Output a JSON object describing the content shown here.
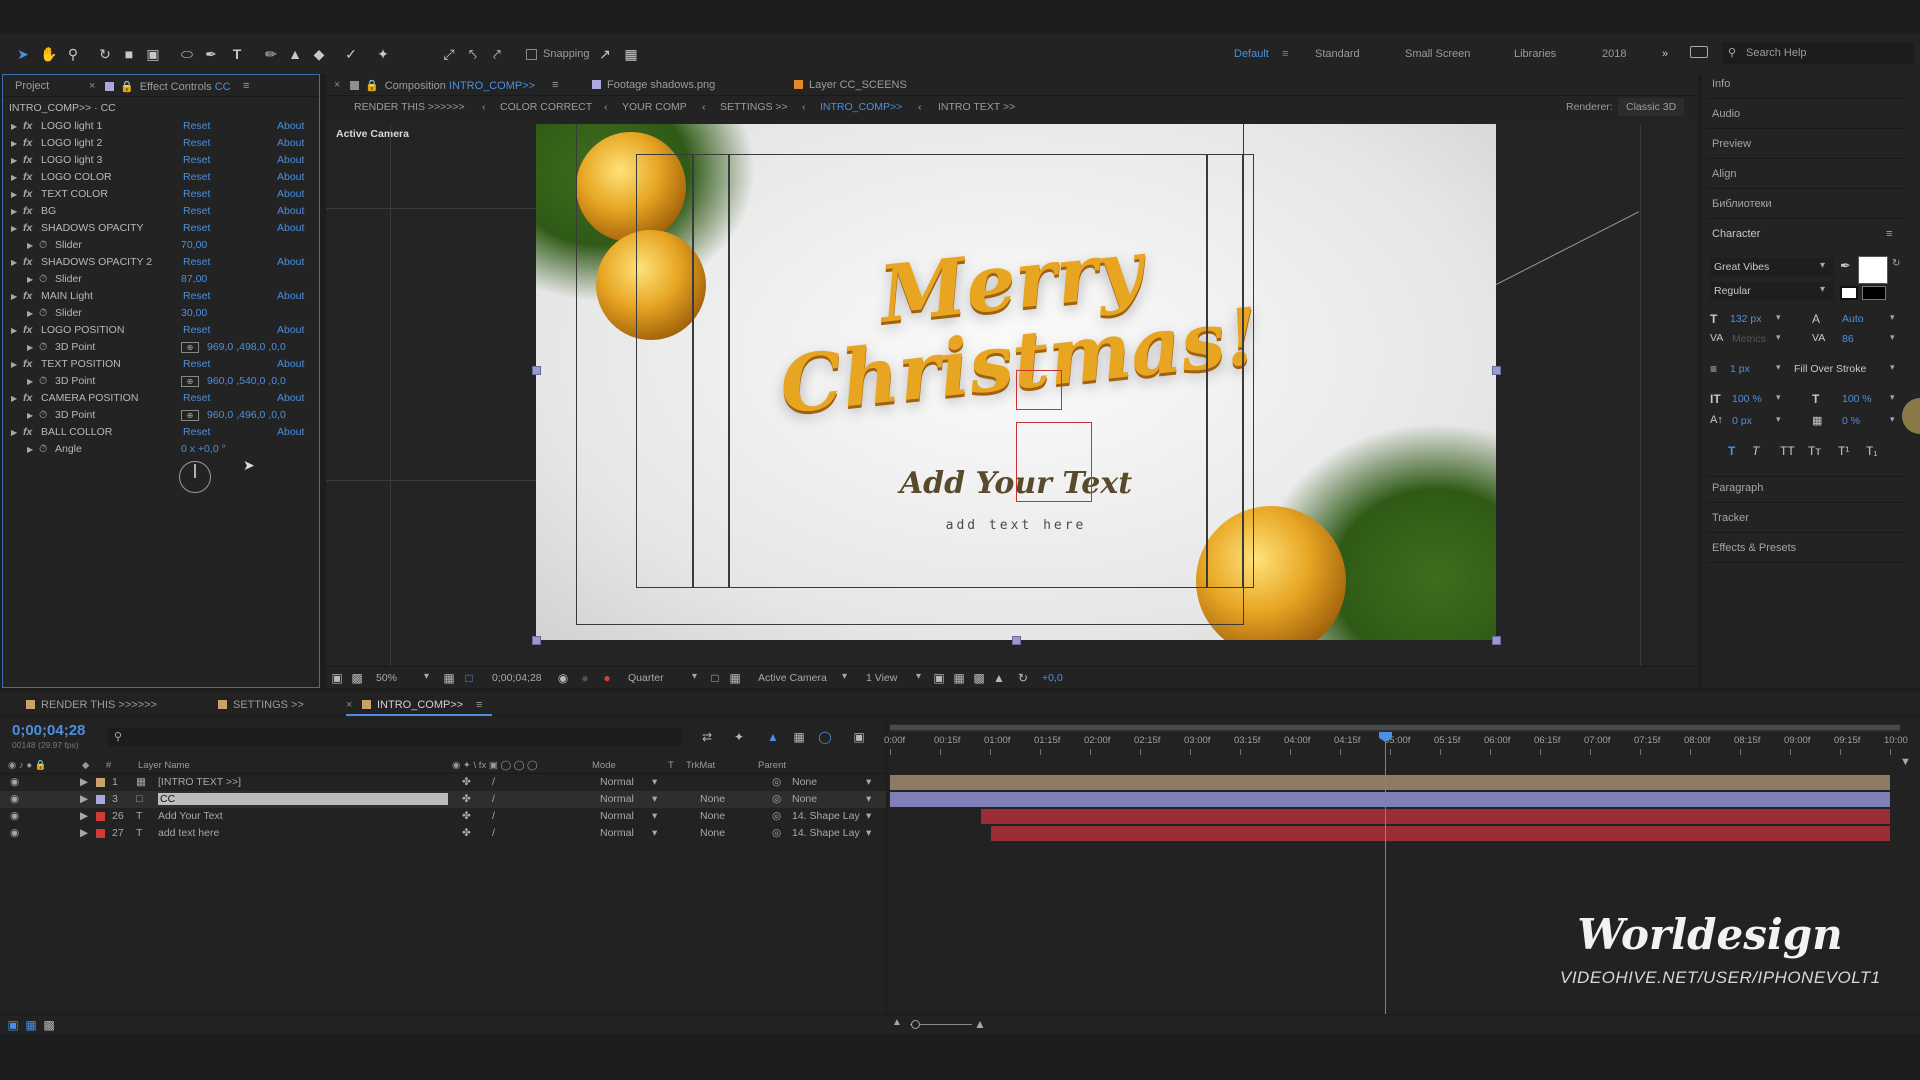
{
  "toolbar": {
    "snapping_label": "Snapping",
    "workspaces": [
      "Default",
      "Standard",
      "Small Screen",
      "Libraries",
      "2018"
    ],
    "search_placeholder": "Search Help"
  },
  "left_panel": {
    "tab_project": "Project",
    "tab_effect_controls": "Effect Controls",
    "tab_effect_target": "CC",
    "header": "INTRO_COMP>> · CC",
    "effects": [
      {
        "name": "LOGO light 1",
        "reset": "Reset",
        "about": "About"
      },
      {
        "name": "LOGO light 2",
        "reset": "Reset",
        "about": "About"
      },
      {
        "name": "LOGO light 3",
        "reset": "Reset",
        "about": "About"
      },
      {
        "name": "LOGO COLOR",
        "reset": "Reset",
        "about": "About"
      },
      {
        "name": "TEXT COLOR",
        "reset": "Reset",
        "about": "About"
      },
      {
        "name": "BG",
        "reset": "Reset",
        "about": "About"
      },
      {
        "name": "SHADOWS OPACITY",
        "reset": "Reset",
        "about": "About"
      },
      {
        "name": "Slider",
        "value": "70,00"
      },
      {
        "name": "SHADOWS OPACITY 2",
        "reset": "Reset",
        "about": "About"
      },
      {
        "name": "Slider",
        "value": "87,00"
      },
      {
        "name": "MAIN Light",
        "reset": "Reset",
        "about": "About"
      },
      {
        "name": "Slider",
        "value": "30,00"
      },
      {
        "name": "LOGO POSITION",
        "reset": "Reset",
        "about": "About"
      },
      {
        "name": "3D Point",
        "value": "969,0 ,498,0 ,0,0"
      },
      {
        "name": "TEXT POSITION",
        "reset": "Reset",
        "about": "About"
      },
      {
        "name": "3D Point",
        "value": "960,0 ,540,0 ,0,0"
      },
      {
        "name": "CAMERA POSITION",
        "reset": "Reset",
        "about": "About"
      },
      {
        "name": "3D Point",
        "value": "960,0 ,496,0 ,0,0"
      },
      {
        "name": "BALL COLLOR",
        "reset": "Reset",
        "about": "About"
      },
      {
        "name": "Angle",
        "value": "0 x +0,0 °"
      }
    ]
  },
  "comp_panel": {
    "tab_composition_prefix": "Composition",
    "tab_composition_name": "INTRO_COMP>>",
    "tab_footage": "Footage shadows.png",
    "tab_layer": "Layer CC_SCEENS",
    "breadcrumbs": [
      "RENDER THIS >>>>>>",
      "COLOR CORRECT",
      "YOUR COMP",
      "SETTINGS >>",
      "INTRO_COMP>>",
      "INTRO TEXT >>"
    ],
    "renderer_label": "Renderer:",
    "renderer_value": "Classic 3D",
    "active_camera_label": "Active Camera",
    "canvas_title": "Merry Christmas!",
    "canvas_subtitle": "Add Your Text",
    "canvas_small": "add text here",
    "footer": {
      "zoom": "50%",
      "timecode": "0;00;04;28",
      "resolution": "Quarter",
      "camera": "Active Camera",
      "views": "1 View",
      "exposure": "+0,0"
    }
  },
  "right_panel": {
    "items": [
      "Info",
      "Audio",
      "Preview",
      "Align",
      "Библиотеки",
      "Character"
    ],
    "font": "Great Vibes",
    "style": "Regular",
    "size": "132 px",
    "leading": "Auto",
    "kerning": "Metrics",
    "tracking": "86",
    "stroke_width": "1 px",
    "stroke_type": "Fill Over Stroke",
    "vscale": "100 %",
    "hscale": "100 %",
    "baseline": "0 px",
    "tsume": "0 %",
    "lower_items": [
      "Paragraph",
      "Tracker",
      "Effects & Presets"
    ]
  },
  "timeline": {
    "tabs": [
      "RENDER THIS >>>>>>",
      "SETTINGS >>",
      "INTRO_COMP>>"
    ],
    "timecode": "0;00;04;28",
    "frame_info": "00148 (29.97 fps)",
    "columns": {
      "name": "Layer Name",
      "mode": "Mode",
      "t": "T",
      "trkmat": "TrkMat",
      "parent": "Parent"
    },
    "ruler": [
      "0:00f",
      "00:15f",
      "01:00f",
      "01:15f",
      "02:00f",
      "02:15f",
      "03:00f",
      "03:15f",
      "04:00f",
      "04:15f",
      "05:00f",
      "05:15f",
      "06:00f",
      "06:15f",
      "07:00f",
      "07:15f",
      "08:00f",
      "08:15f",
      "09:00f",
      "09:15f",
      "10:00"
    ],
    "playhead_fraction": 0.495,
    "layers": [
      {
        "num": "1",
        "name": "[INTRO TEXT >>]",
        "mode": "Normal",
        "trkmat": "",
        "parent": "None",
        "color": "#c8a26a",
        "bar": "#8d7b63"
      },
      {
        "num": "3",
        "name": "CC",
        "mode": "Normal",
        "trkmat": "None",
        "parent": "None",
        "color": "#a9a9e0",
        "bar": "#8080b8"
      },
      {
        "num": "26",
        "name": "Add Your Text",
        "mode": "Normal",
        "trkmat": "None",
        "parent": "14. Shape Lay",
        "color": "#d03a3a",
        "bar": "#9a2e36"
      },
      {
        "num": "27",
        "name": "add text here",
        "mode": "Normal",
        "trkmat": "None",
        "parent": "14. Shape Lay",
        "color": "#d03a3a",
        "bar": "#9a2e36"
      }
    ]
  },
  "watermark": {
    "brand": "Worldesign",
    "url": "VIDEOHIVE.NET/USER/IPHONEVOLT1"
  }
}
